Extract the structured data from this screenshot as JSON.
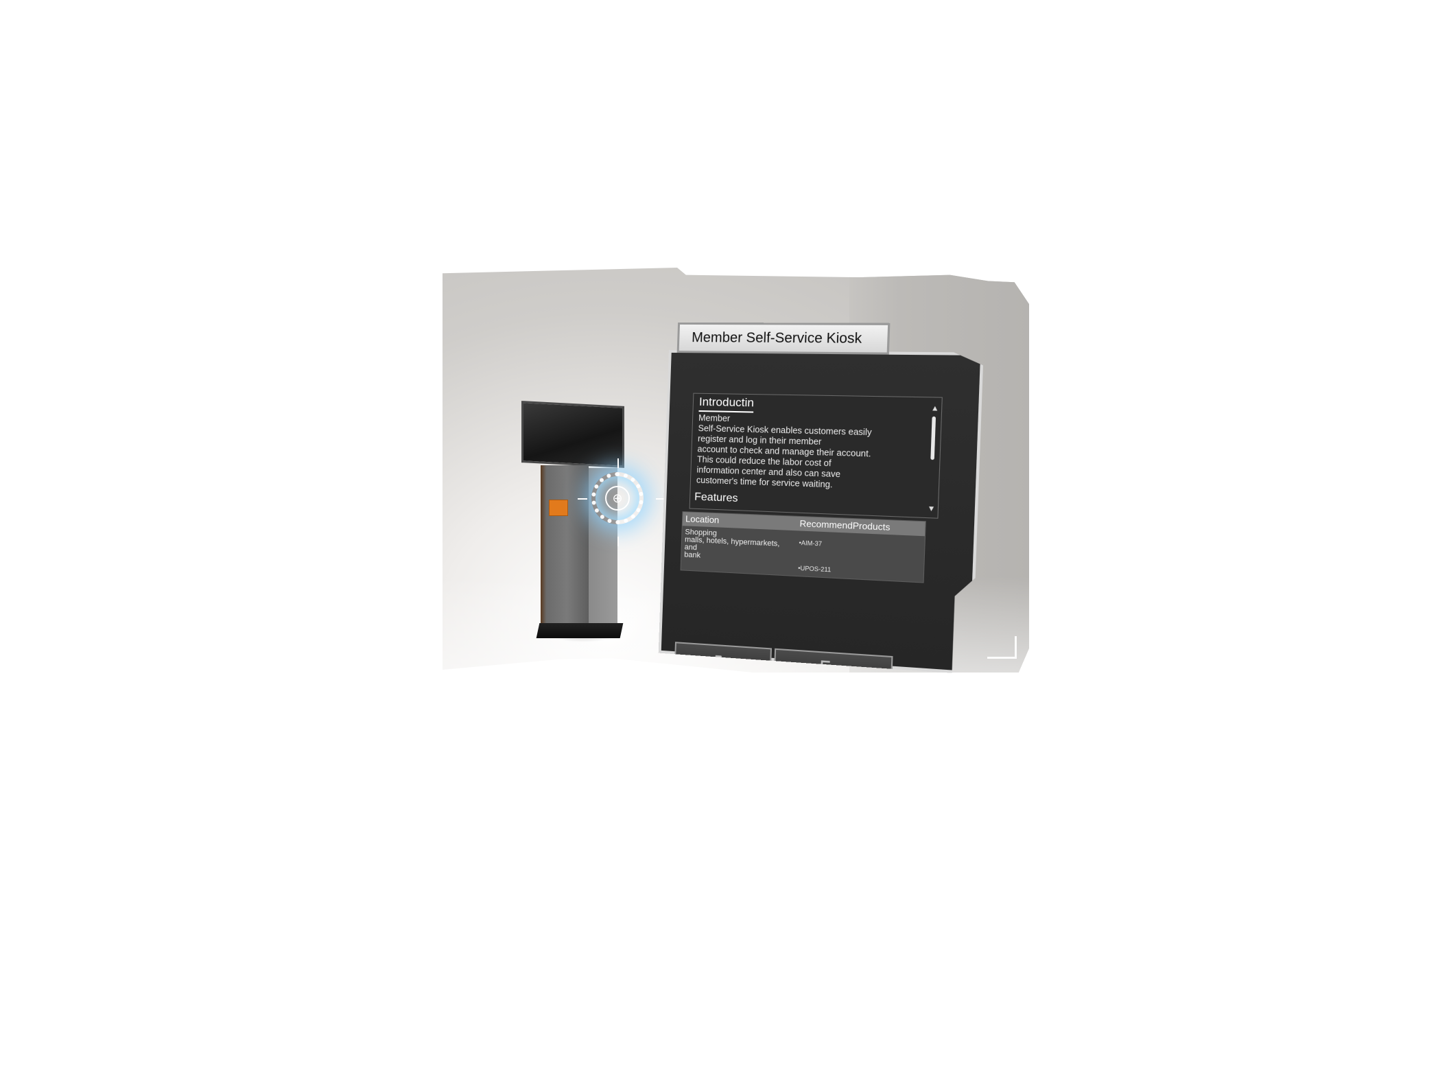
{
  "panel": {
    "title": "Member Self-Service Kiosk",
    "introduction": {
      "heading": "Introductin",
      "text": "Member\nSelf-Service Kiosk enables customers easily\nregister and log in their member\naccount to check and manage their account.\nThis could reduce the labor cost of\ninformation center and also can save\ncustomer's time for service waiting."
    },
    "features_heading": "Features",
    "table": {
      "headers": [
        "Location",
        "RecommendProducts"
      ],
      "location": "Shopping\nmalls, hotels, hypermarkets,\nand\nbank",
      "products": [
        "•AIM-37",
        "•UPOS-211"
      ]
    },
    "buttons": {
      "refresh_icon": "refresh-icon",
      "exit_icon": "exit-icon"
    }
  },
  "colors": {
    "panel_bg": "#2f2f2f",
    "kiosk_accent": "#e27a1c",
    "target_glow": "#8cd2ff"
  }
}
